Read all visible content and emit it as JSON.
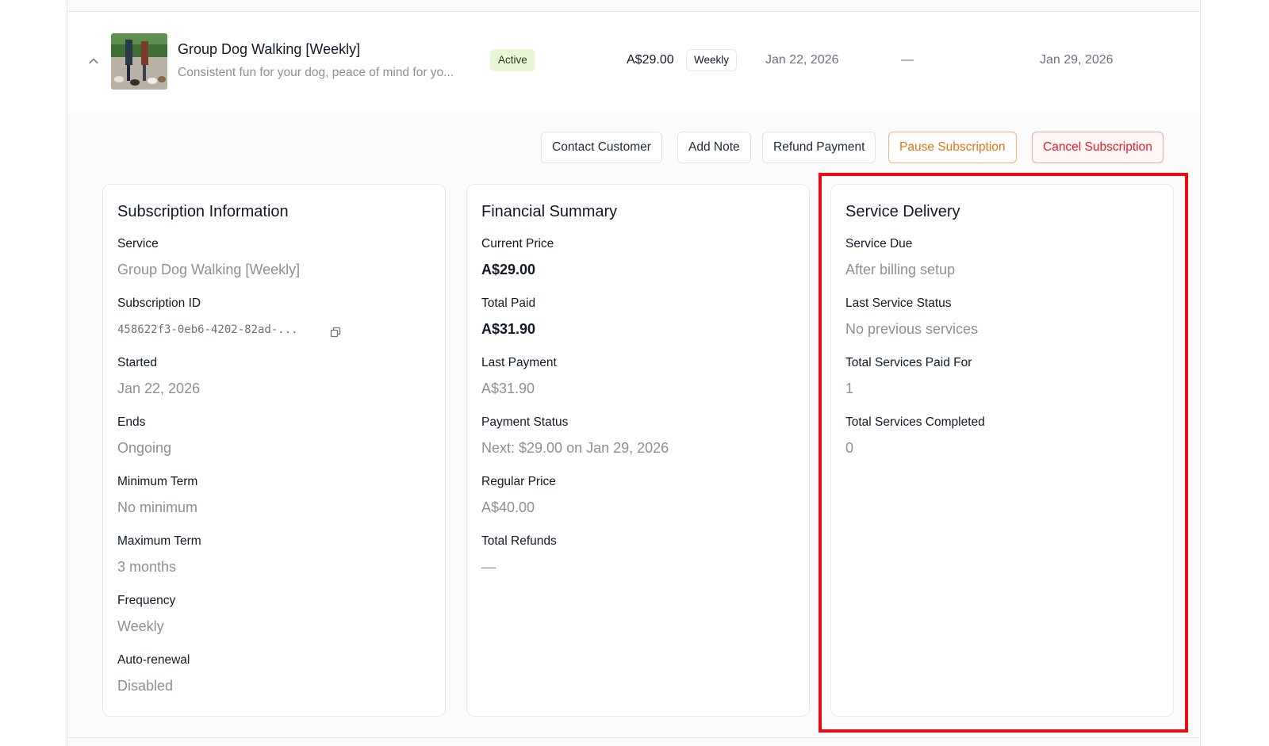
{
  "subscription_row": {
    "title": "Group Dog Walking [Weekly]",
    "description": "Consistent fun for your dog, peace of mind for yo...",
    "status": "Active",
    "price": "A$29.00",
    "frequency_badge": "Weekly",
    "start_date": "Jan 22, 2026",
    "end_date": "—",
    "next_date": "Jan 29, 2026",
    "icons": {
      "collapse": "chevron-up-icon",
      "thumbnail": "dog-walking-photo"
    }
  },
  "actions": {
    "contact": "Contact Customer",
    "note": "Add Note",
    "refund": "Refund Payment",
    "pause": "Pause Subscription",
    "cancel": "Cancel Subscription"
  },
  "subscription_info": {
    "title": "Subscription Information",
    "fields": [
      {
        "label": "Service",
        "value": "Group Dog Walking [Weekly]"
      },
      {
        "label": "Subscription ID",
        "value": "458622f3-0eb6-4202-82ad-..."
      },
      {
        "label": "Started",
        "value": "Jan 22, 2026"
      },
      {
        "label": "Ends",
        "value": "Ongoing"
      },
      {
        "label": "Minimum Term",
        "value": "No minimum"
      },
      {
        "label": "Maximum Term",
        "value": "3 months"
      },
      {
        "label": "Frequency",
        "value": "Weekly"
      },
      {
        "label": "Auto-renewal",
        "value": "Disabled"
      }
    ]
  },
  "financial_summary": {
    "title": "Financial Summary",
    "fields": [
      {
        "label": "Current Price",
        "value": "A$29.00"
      },
      {
        "label": "Total Paid",
        "value": "A$31.90"
      },
      {
        "label": "Last Payment",
        "value": "A$31.90"
      },
      {
        "label": "Payment Status",
        "value": "Next: $29.00 on Jan 29, 2026"
      },
      {
        "label": "Regular Price",
        "value": "A$40.00"
      },
      {
        "label": "Total Refunds",
        "value": "—"
      }
    ]
  },
  "service_delivery": {
    "title": "Service Delivery",
    "fields": [
      {
        "label": "Service Due",
        "value": "After billing setup"
      },
      {
        "label": "Last Service Status",
        "value": "No previous services"
      },
      {
        "label": "Total Services Paid For",
        "value": "1"
      },
      {
        "label": "Total Services Completed",
        "value": "0"
      }
    ]
  },
  "colors": {
    "active_badge_bg": "#e9f7d4",
    "pause_accent": "#e07514",
    "cancel_accent": "#e11d2a",
    "highlight_border": "#ea0d10"
  }
}
